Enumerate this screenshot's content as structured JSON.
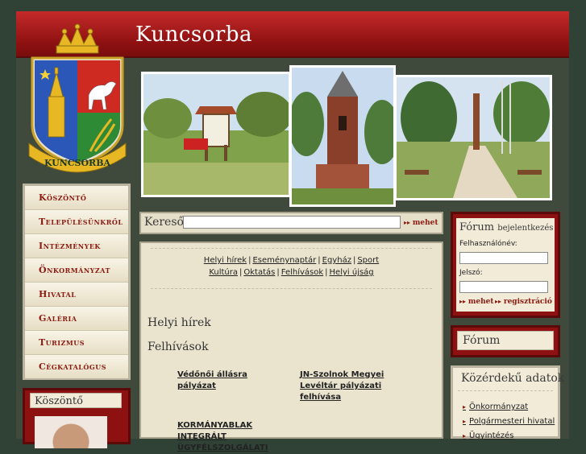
{
  "header": {
    "title": "Kuncsorba"
  },
  "coat_of_arms": {
    "label": "KUNCSORBA",
    "icon": "coat-of-arms-icon"
  },
  "nav": {
    "items": [
      {
        "label": "Köszöntő"
      },
      {
        "label": "Településünkről"
      },
      {
        "label": "Intézmények"
      },
      {
        "label": "Önkormányzat"
      },
      {
        "label": "Hivatal"
      },
      {
        "label": "Galéria"
      },
      {
        "label": "Turizmus"
      },
      {
        "label": "Cégkatalógus"
      }
    ]
  },
  "welcome_box": {
    "title": "Köszöntő"
  },
  "search": {
    "label": "Kereső",
    "value": "",
    "go_label": "mehet"
  },
  "content": {
    "sublinks_row1": [
      "Helyi hírek",
      "Eseménynaptár",
      "Egyház",
      "Sport"
    ],
    "sublinks_row2": [
      "Kultúra",
      "Oktatás",
      "Felhívások",
      "Helyi újság"
    ],
    "heading_news": "Helyi hírek",
    "heading_calls": "Felhívások",
    "call_links": [
      {
        "text": "Védőnői állásra pályázat"
      },
      {
        "text": "JN-Szolnok Megyei Levéltár pályázati felhívása"
      },
      {
        "text": "KORMÁNYABLAK INTEGRÁLT ÜGYFÉLSZOLGÁLATI"
      }
    ]
  },
  "login": {
    "title": "Fórum",
    "subtitle": "bejelentkezés",
    "username_label": "Felhasználónév:",
    "password_label": "Jelszó:",
    "username_value": "",
    "password_value": "",
    "go_label": "mehet",
    "register_label": "regisztráció"
  },
  "forum": {
    "title": "Fórum"
  },
  "public_data": {
    "title": "Közérdekű adatok",
    "links": [
      {
        "text": "Önkormányzat"
      },
      {
        "text": "Polgármesteri hivatal"
      },
      {
        "text": "Ügyintézés"
      }
    ]
  },
  "colors": {
    "header_red": "#8e1111",
    "nav_text": "#8c1a10",
    "background": "#2f4235",
    "panel": "#eae4ce"
  }
}
